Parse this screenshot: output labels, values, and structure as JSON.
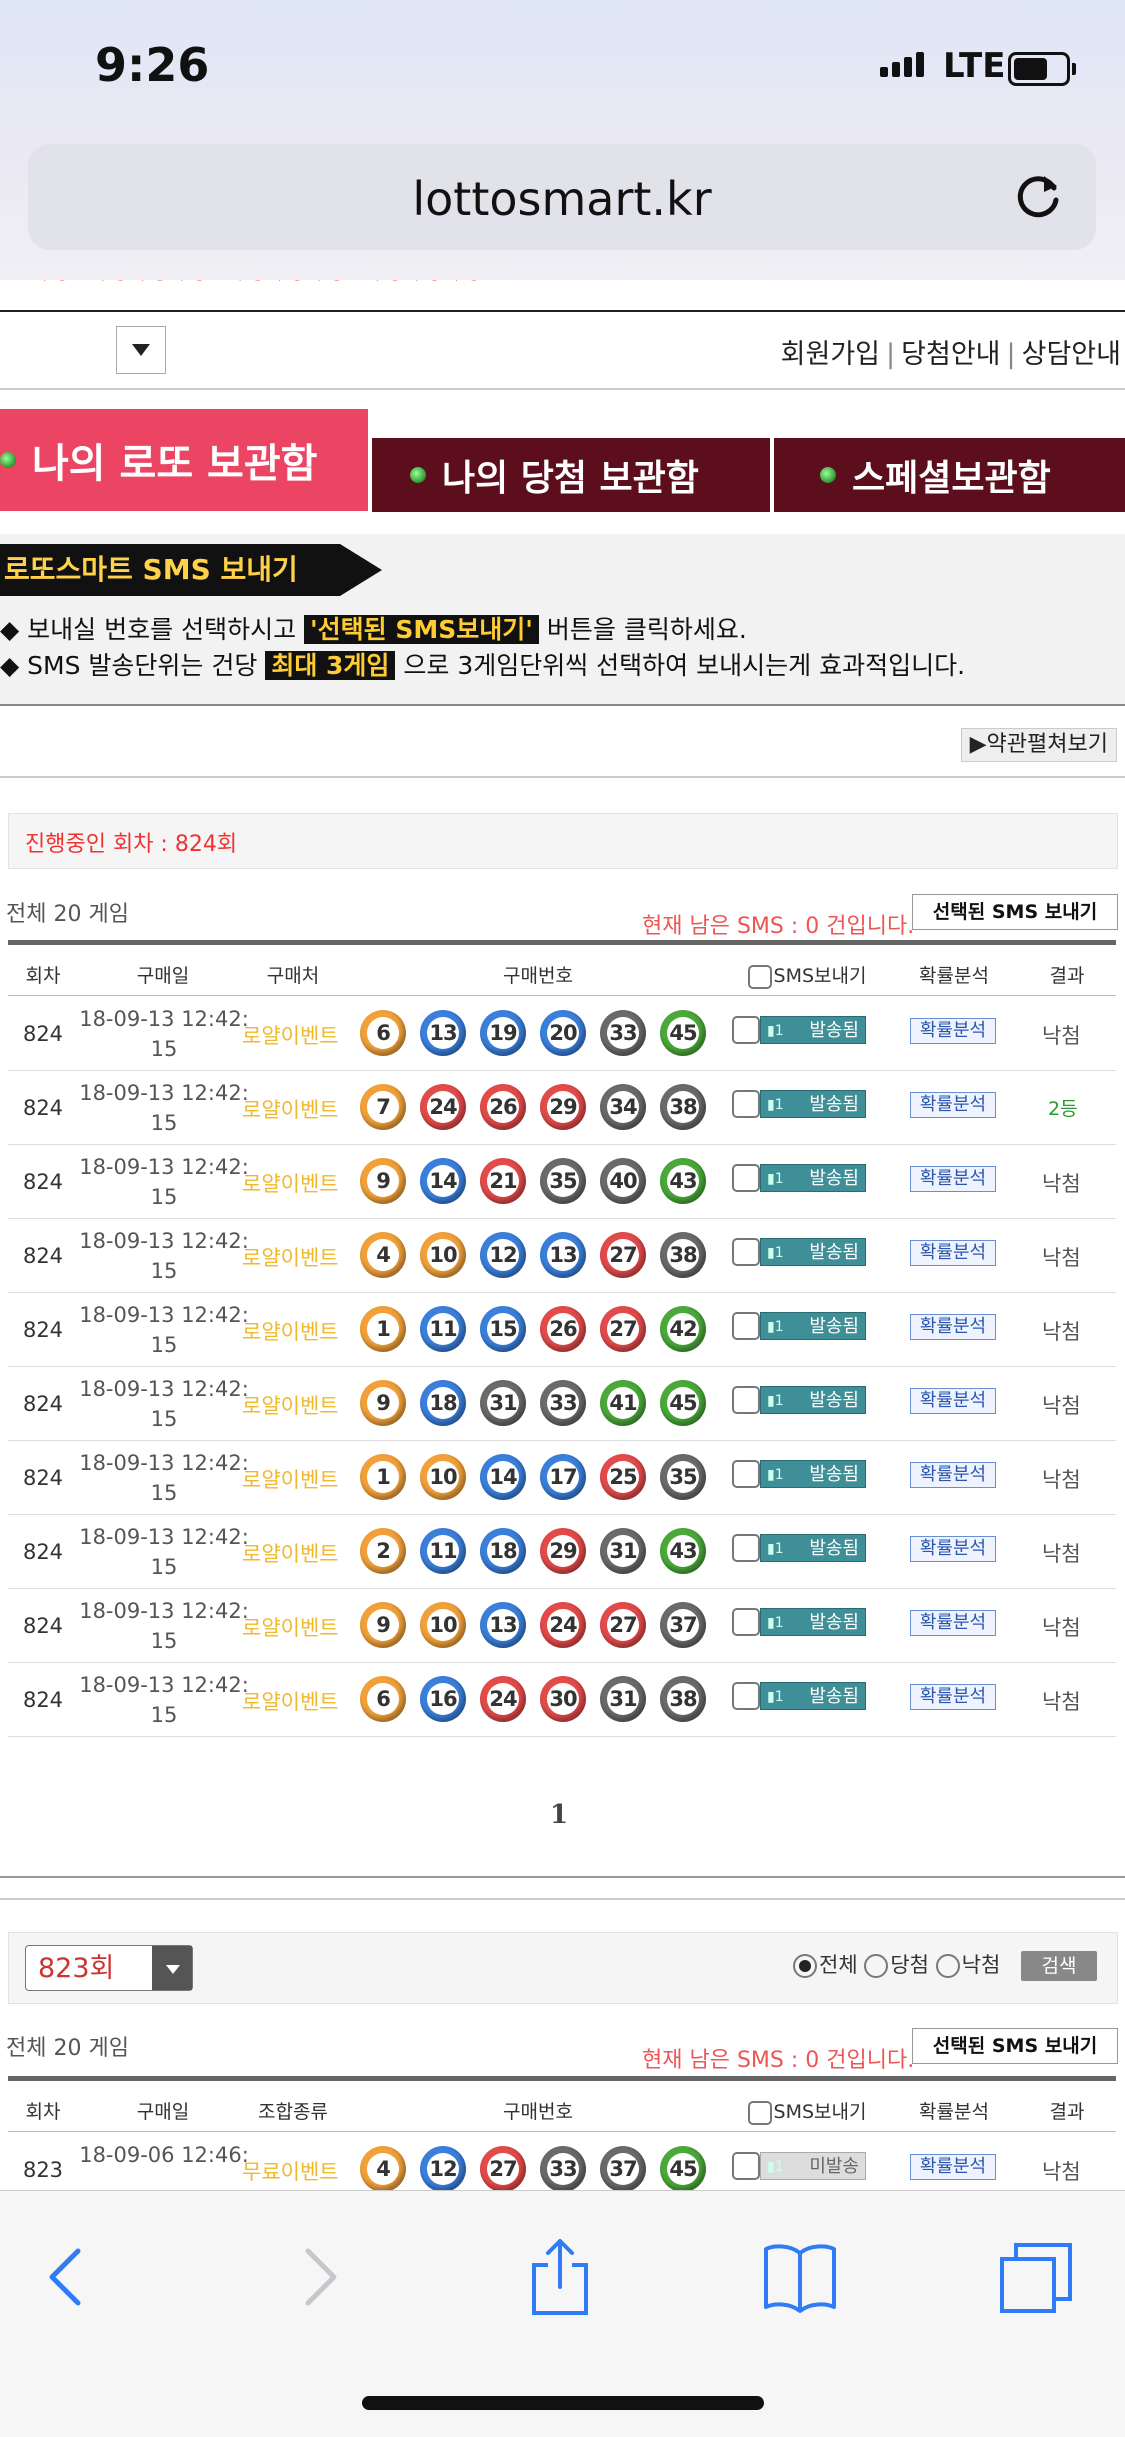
{
  "status_bar": {
    "time": "9:26",
    "network": "LTE"
  },
  "browser": {
    "url": "lottosmart.kr"
  },
  "top_links": [
    "회원가입",
    "당첨안내",
    "상담안내"
  ],
  "tabs": [
    {
      "label": "나의 로또 보관함"
    },
    {
      "label": "나의 당첨 보관함"
    },
    {
      "label": "스페셜보관함"
    }
  ],
  "sms_section": {
    "title": "로또스마트 SMS 보내기",
    "notice1_a": "◆ 보내실 번호를 선택하시고 ",
    "notice1_hl": "'선택된 SMS보내기'",
    "notice1_b": " 버튼을 클릭하세요.",
    "notice2_a": "◆ SMS 발송단위는 건당 ",
    "notice2_hl": "최대 3게임",
    "notice2_b": " 으로 3게임단위씩 선택하여 보내시는게 효과적입니다.",
    "terms_button": "▶약관펼쳐보기"
  },
  "current_round": "진행중인 회차 : 824회",
  "section1": {
    "total": "전체 20 게임",
    "remaining": "현재 남은 SMS : 0 건입니다.",
    "send_button": "선택된 SMS 보내기",
    "headers": {
      "round": "회차",
      "date": "구매일",
      "shop": "구매처",
      "numbers": "구매번호",
      "sms": "SMS보내기",
      "prob": "확률분석",
      "result": "결과"
    },
    "rows": [
      {
        "round": "824",
        "date": "18-09-13 12:42:",
        "time": "15",
        "shop": "로얄이벤트",
        "numbers": [
          6,
          13,
          19,
          20,
          33,
          45
        ],
        "status": "발송됨",
        "prob": "확률분석",
        "result": "낙첨"
      },
      {
        "round": "824",
        "date": "18-09-13 12:42:",
        "time": "15",
        "shop": "로얄이벤트",
        "numbers": [
          7,
          24,
          26,
          29,
          34,
          38
        ],
        "status": "발송됨",
        "prob": "확률분석",
        "result": "2등"
      },
      {
        "round": "824",
        "date": "18-09-13 12:42:",
        "time": "15",
        "shop": "로얄이벤트",
        "numbers": [
          9,
          14,
          21,
          35,
          40,
          43
        ],
        "status": "발송됨",
        "prob": "확률분석",
        "result": "낙첨"
      },
      {
        "round": "824",
        "date": "18-09-13 12:42:",
        "time": "15",
        "shop": "로얄이벤트",
        "numbers": [
          4,
          10,
          12,
          13,
          27,
          38
        ],
        "status": "발송됨",
        "prob": "확률분석",
        "result": "낙첨"
      },
      {
        "round": "824",
        "date": "18-09-13 12:42:",
        "time": "15",
        "shop": "로얄이벤트",
        "numbers": [
          1,
          11,
          15,
          26,
          27,
          42
        ],
        "status": "발송됨",
        "prob": "확률분석",
        "result": "낙첨"
      },
      {
        "round": "824",
        "date": "18-09-13 12:42:",
        "time": "15",
        "shop": "로얄이벤트",
        "numbers": [
          9,
          18,
          31,
          33,
          41,
          45
        ],
        "status": "발송됨",
        "prob": "확률분석",
        "result": "낙첨"
      },
      {
        "round": "824",
        "date": "18-09-13 12:42:",
        "time": "15",
        "shop": "로얄이벤트",
        "numbers": [
          1,
          10,
          14,
          17,
          25,
          35
        ],
        "status": "발송됨",
        "prob": "확률분석",
        "result": "낙첨"
      },
      {
        "round": "824",
        "date": "18-09-13 12:42:",
        "time": "15",
        "shop": "로얄이벤트",
        "numbers": [
          2,
          11,
          18,
          29,
          31,
          43
        ],
        "status": "발송됨",
        "prob": "확률분석",
        "result": "낙첨"
      },
      {
        "round": "824",
        "date": "18-09-13 12:42:",
        "time": "15",
        "shop": "로얄이벤트",
        "numbers": [
          9,
          10,
          13,
          24,
          27,
          37
        ],
        "status": "발송됨",
        "prob": "확률분석",
        "result": "낙첨"
      },
      {
        "round": "824",
        "date": "18-09-13 12:42:",
        "time": "15",
        "shop": "로얄이벤트",
        "numbers": [
          6,
          16,
          24,
          30,
          31,
          38
        ],
        "status": "발송됨",
        "prob": "확률분석",
        "result": "낙첨"
      }
    ]
  },
  "pagination": {
    "current": "1"
  },
  "filter": {
    "round_select": "823회",
    "radio_all": "전체",
    "radio_win": "당첨",
    "radio_lose": "낙첨",
    "search_button": "검색"
  },
  "section2": {
    "total": "전체 20 게임",
    "remaining": "현재 남은 SMS : 0 건입니다.",
    "send_button": "선택된 SMS 보내기",
    "headers": {
      "round": "회차",
      "date": "구매일",
      "shop": "조합종류",
      "numbers": "구매번호",
      "sms": "SMS보내기",
      "prob": "확률분석",
      "result": "결과"
    },
    "rows": [
      {
        "round": "823",
        "date": "18-09-06 12:46:",
        "time": "",
        "shop": "무료이벤트",
        "numbers": [
          4,
          12,
          27,
          33,
          37,
          45
        ],
        "status": "미발송",
        "prob": "확률분석",
        "result": "낙첨"
      }
    ]
  }
}
